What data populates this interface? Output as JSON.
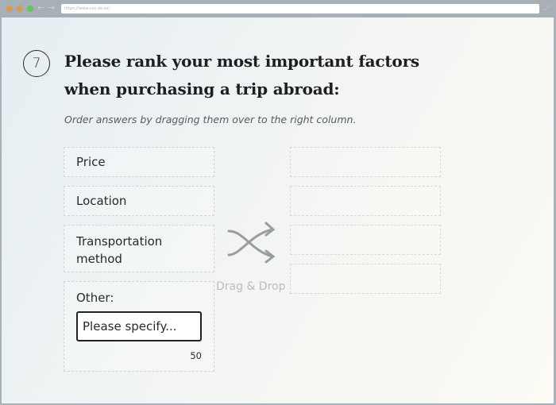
{
  "browser": {
    "url": "https://www.xxx.de.xx/",
    "icons": {
      "close": "window-close-dot",
      "minimize": "window-minimize-dot",
      "maximize": "window-maximize-dot",
      "back": "←",
      "forward": "→",
      "expand": "⤢"
    }
  },
  "question": {
    "number": "7",
    "title": "Please rank your most important factors when purchasing a trip abroad:",
    "instructions": "Order answers by dragging them over to the right column."
  },
  "options": [
    {
      "label": "Price"
    },
    {
      "label": "Location"
    },
    {
      "label": "Transportation method"
    },
    {
      "label": "Other:"
    }
  ],
  "other_input": {
    "value": "",
    "placeholder": "Please specify...",
    "char_remaining": "50"
  },
  "drag_drop": {
    "label": "Drag & Drop",
    "icon": "shuffle-arrows-icon"
  },
  "ranking_slots": [
    {
      "value": ""
    },
    {
      "value": ""
    },
    {
      "value": ""
    },
    {
      "value": ""
    }
  ],
  "colors": {
    "title_text": "#1e1e22",
    "body_text": "#2a2a2a",
    "dashed_border": "#cfd4d6",
    "drag_icon": "#9a9d9f",
    "drag_label": "#b9bdbf"
  }
}
